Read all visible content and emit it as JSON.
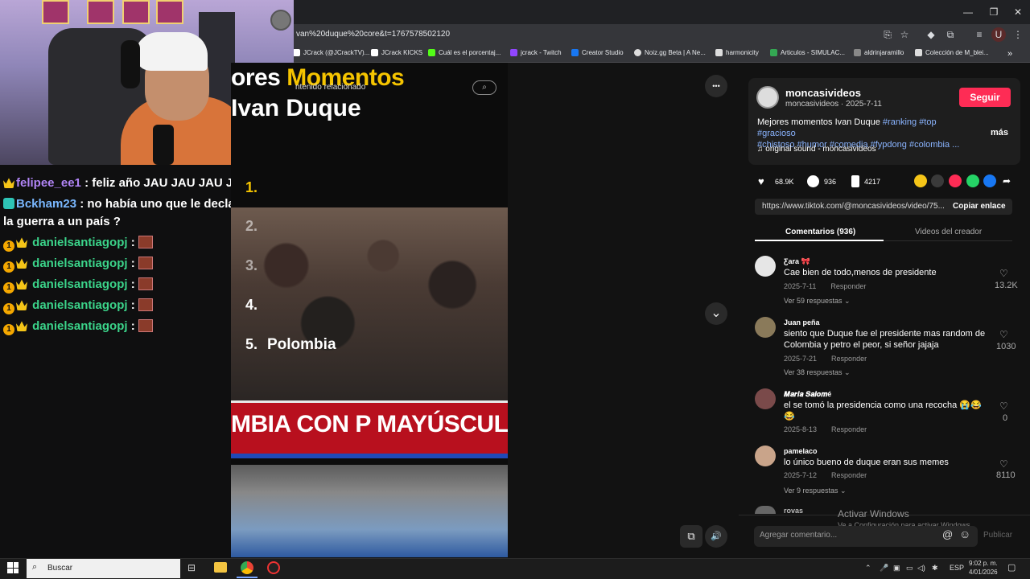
{
  "browser": {
    "url": "van%20duque%20core&t=1767578502120",
    "window_controls": [
      "—",
      "❐",
      "✕"
    ],
    "bookmarks": [
      {
        "label": "JCrack (@JCrackTV)...",
        "color": "#ffffff"
      },
      {
        "label": "JCrack KICKS",
        "color": "#ffffff"
      },
      {
        "label": "Cuál es el porcentaj...",
        "color": "#53fc18"
      },
      {
        "label": "jcrack - Twitch",
        "color": "#9146ff"
      },
      {
        "label": "Creator Studio",
        "color": "#1877f2"
      },
      {
        "label": "Noiz.gg Beta | A Ne...",
        "color": "#dddddd"
      },
      {
        "label": "harmonicity",
        "color": "#dddddd"
      },
      {
        "label": "Articulos - SIMULAC...",
        "color": "#34a853"
      },
      {
        "label": "aldrinjaramillo",
        "color": "#888888"
      },
      {
        "label": "Colección de M_blei...",
        "color": "#dddddd"
      }
    ],
    "bookmarks_overflow": "»"
  },
  "chat": {
    "messages": [
      {
        "user": "felipee_ee1",
        "user_color": "#b084f5",
        "text": ": feliz año JAU JAU JAU JAU",
        "badge": "crown"
      },
      {
        "user": "Bckham23",
        "user_color": "#7ab8ff",
        "text": ": no había uno que le declaró",
        "badge": "bot"
      },
      {
        "user": "",
        "user_color": "#ffffff",
        "text": "la guerra a un país ?",
        "badge": ""
      },
      {
        "user": "danielsantiagopj",
        "user_color": "#3bd48a",
        "text": ":",
        "badge": "one-crown"
      },
      {
        "user": "danielsantiagopj",
        "user_color": "#3bd48a",
        "text": ":",
        "badge": "one-crown"
      },
      {
        "user": "danielsantiagopj",
        "user_color": "#3bd48a",
        "text": ":",
        "badge": "one-crown"
      },
      {
        "user": "danielsantiagopj",
        "user_color": "#3bd48a",
        "text": ":",
        "badge": "one-crown"
      },
      {
        "user": "danielsantiagopj",
        "user_color": "#3bd48a",
        "text": ":",
        "badge": "one-crown"
      }
    ]
  },
  "video": {
    "title_white": "ores",
    "title_yellow": "Momentos",
    "title_line2": "Ivan Duque",
    "related_label": "ntenido relacionado",
    "numbers": [
      "1.",
      "2.",
      "3.",
      "4.",
      "5."
    ],
    "number5_label": "Polombia",
    "banner_text": "MBIA CON P MAYÚSCUL",
    "more_icon": "•••",
    "next_icon": "⌄",
    "pip_icon": "⧉",
    "volume_icon": "🔊"
  },
  "panel": {
    "author": "moncasivideos",
    "author_meta": "moncasivideos · 2025-7-11",
    "follow": "Seguir",
    "desc_text": "Mejores momentos Ivan Duque",
    "desc_tags_line1": "#ranking #top #gracioso",
    "desc_tags_line2": "#chistoso #humor #comedia #fypdong #colombia ...",
    "more": "más",
    "sound": "♫  original sound - moncasivideos",
    "likes": "68.9K",
    "comments": "936",
    "saves": "4217",
    "link": "https://www.tiktok.com/@moncasivideos/video/75...",
    "copy_link": "Copiar enlace",
    "tab_comments": "Comentarios (936)",
    "tab_creator": "Videos del creador",
    "comments_list": [
      {
        "name": "Ƹara 🎀",
        "text": "Cae bien de todo,menos de presidente",
        "date": "2025-7-11",
        "reply": "Responder",
        "likes": "13.2K",
        "replies": "Ver 59 respuestas ⌄",
        "avatar": "#e6e6e6"
      },
      {
        "name": "Juan peña",
        "text": "siento que Duque fue el presidente mas random de Colombia y petro el peor, si señor jajaja",
        "date": "2025-7-21",
        "reply": "Responder",
        "likes": "1030",
        "replies": "Ver 38 respuestas ⌄",
        "avatar": "#8a7a5a"
      },
      {
        "name": "𝑴𝒂𝒓𝒊𝒂 𝑺𝒂𝒍𝒐𝒎é",
        "text": "el se tomó la presidencia como una recocha 😭😂 😂",
        "date": "2025-8-13",
        "reply": "Responder",
        "likes": "0",
        "replies": "",
        "avatar": "#7a4a4a"
      },
      {
        "name": "pamelaco",
        "text": "lo único bueno de duque eran sus memes",
        "date": "2025-7-12",
        "reply": "Responder",
        "likes": "8110",
        "replies": "Ver 9 respuestas ⌄",
        "avatar": "#c9a48a"
      }
    ],
    "partial_name": "rovas",
    "comment_placeholder": "Agregar comentario...",
    "publish": "Publicar",
    "activate_title": "Activar Windows",
    "activate_sub": "Ve a Configuración para activar Windows."
  },
  "taskbar": {
    "search": "Buscar",
    "lang": "ESP",
    "time": "9:02 p. m.",
    "date": "4/01/2026"
  }
}
